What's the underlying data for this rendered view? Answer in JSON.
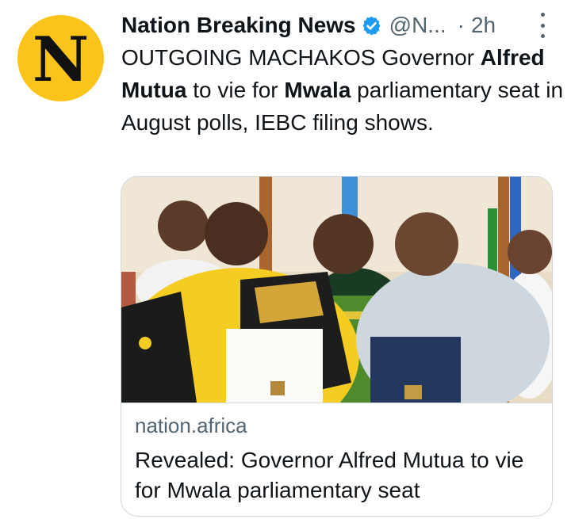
{
  "tweet": {
    "avatar_letter": "N",
    "author_name": "Nation Breaking News",
    "handle": "@N...",
    "separator": "·",
    "time": "2h",
    "text": {
      "part1": "OUTGOING MACHAKOS Governor ",
      "bold1": "Alfred Mutua",
      "part2": " to vie for ",
      "bold2": "Mwala",
      "part3": " parliamentary seat in August polls, IEBC filing shows."
    }
  },
  "card": {
    "domain": "nation.africa",
    "title": "Revealed: Governor Alfred Mutua to vie for Mwala parliamentary seat"
  },
  "icons": {
    "verified": "verified-badge-icon",
    "more": "more-options-icon"
  },
  "colors": {
    "avatar_bg": "#fbc41b",
    "verified": "#1d9bf0",
    "secondary_text": "#536471",
    "card_border": "#cfd9de"
  }
}
